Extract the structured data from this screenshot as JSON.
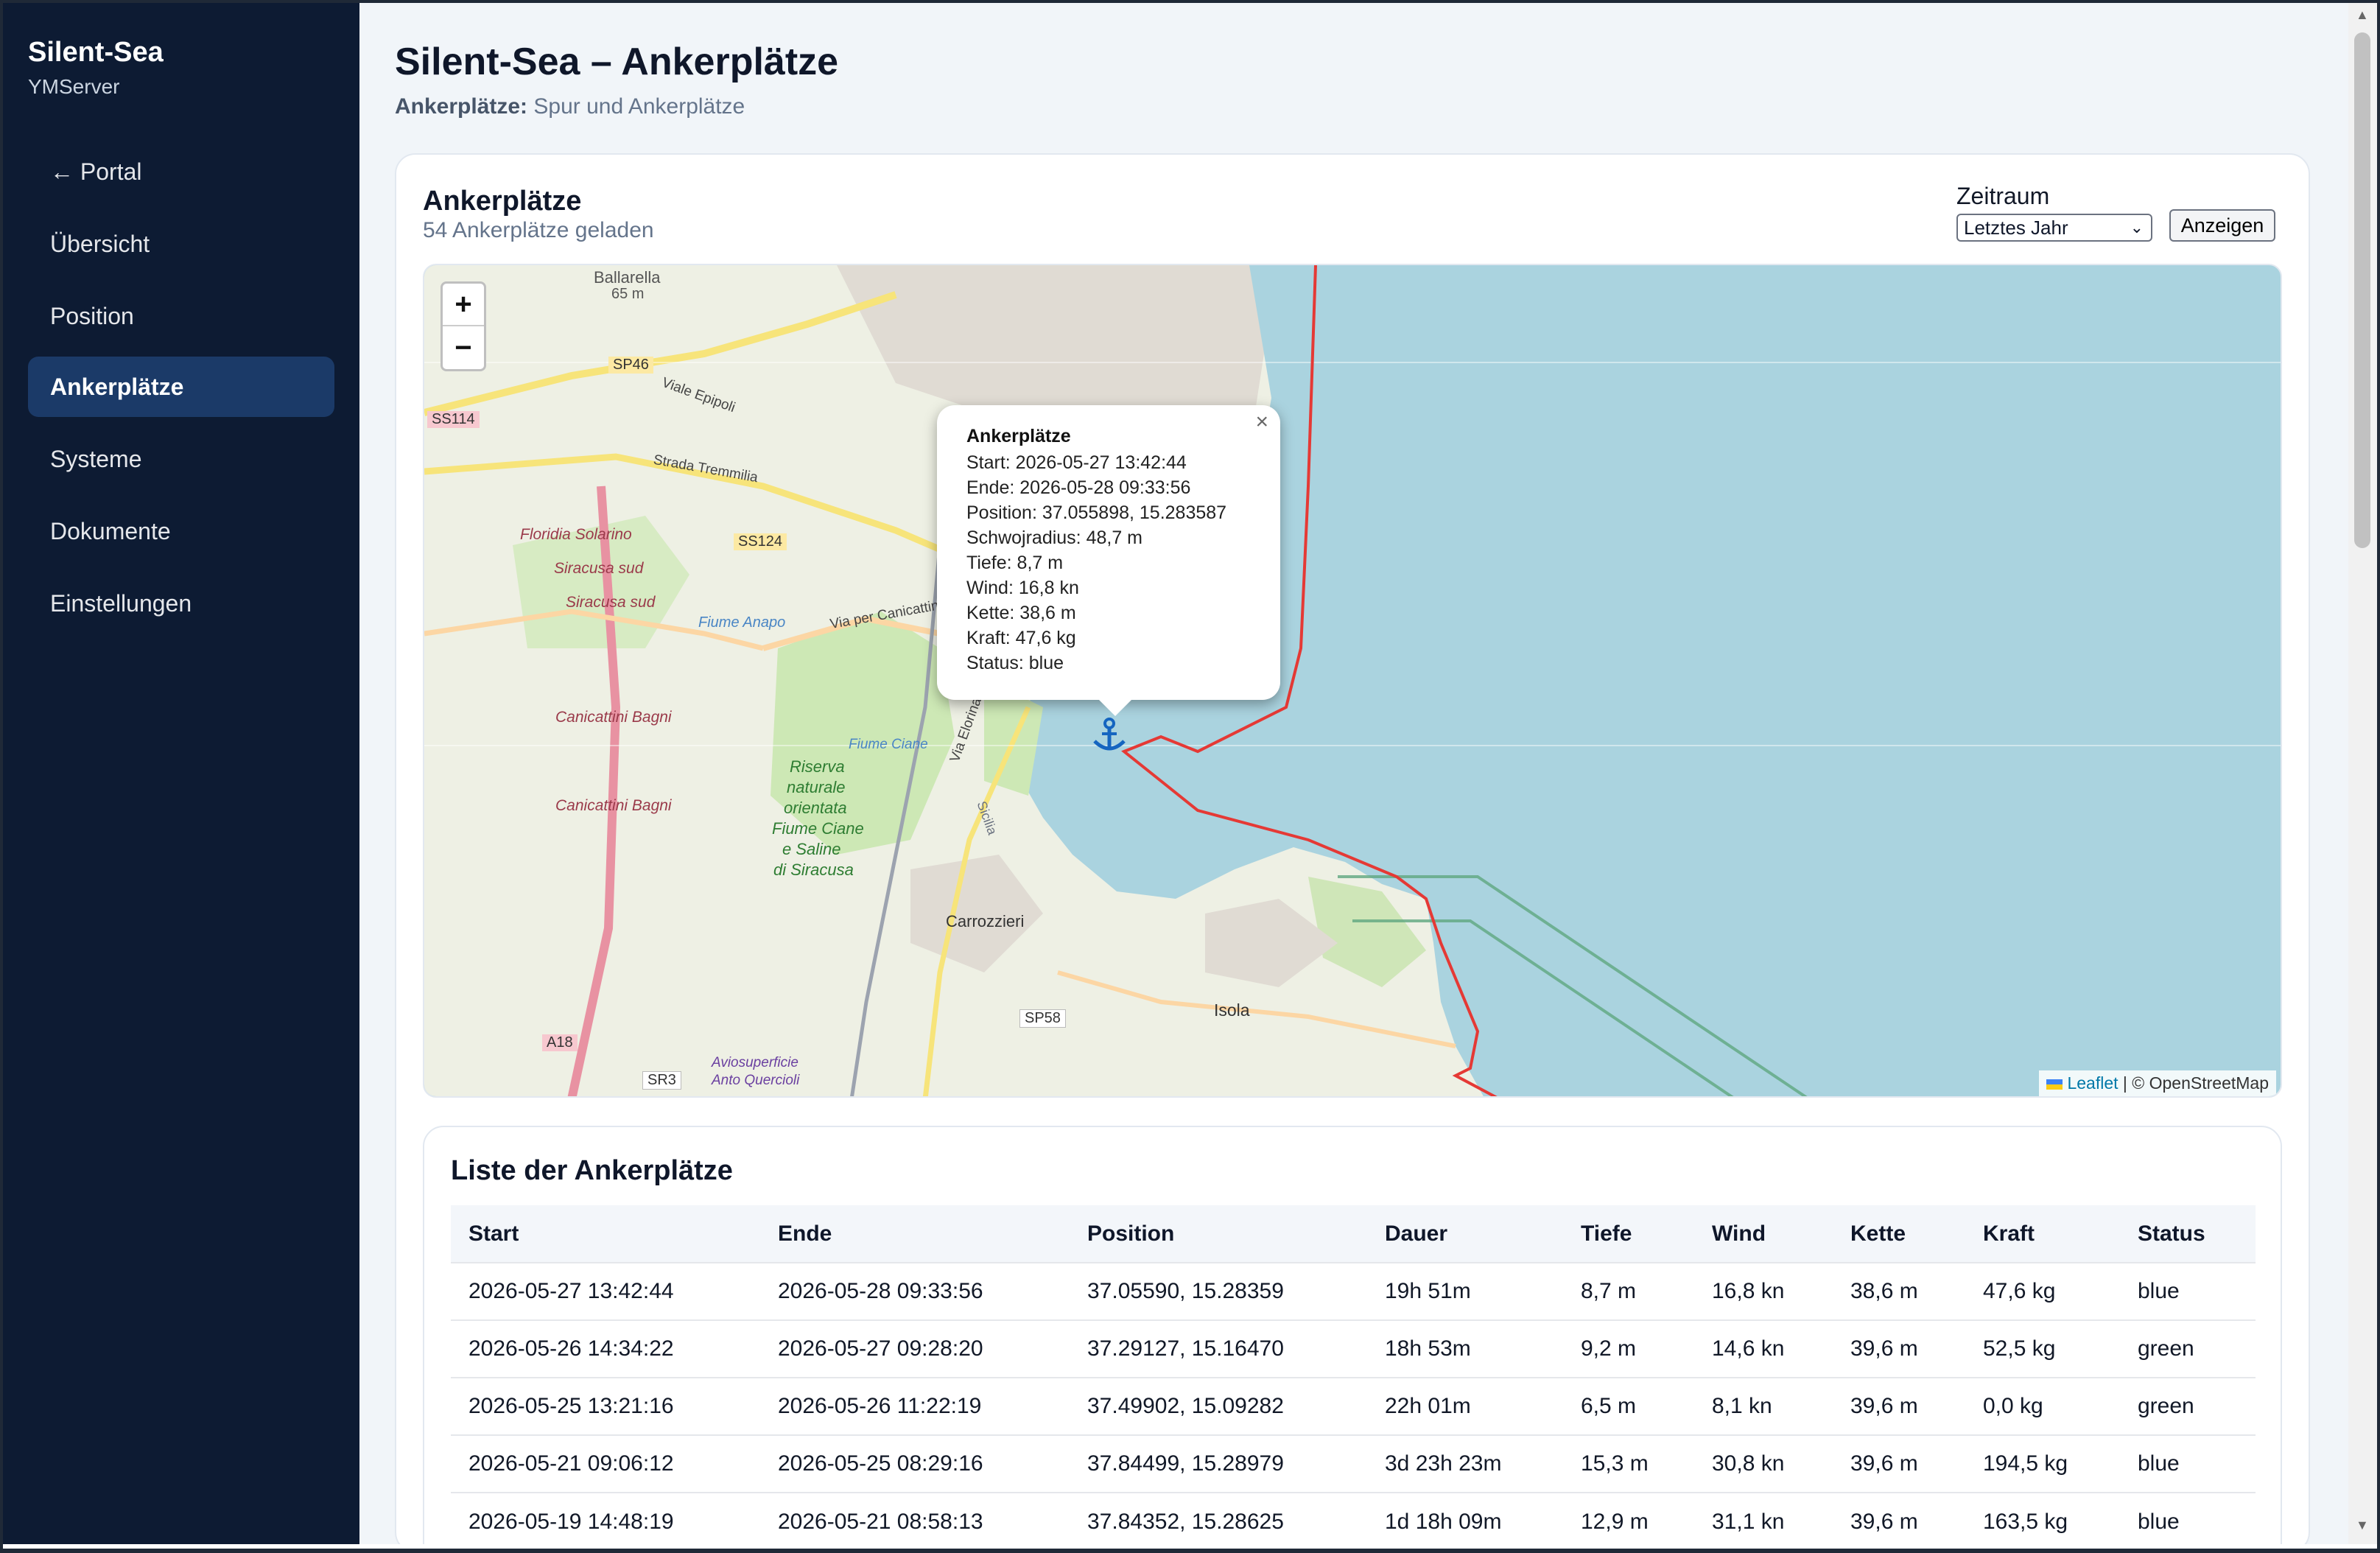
{
  "sidebar": {
    "brand_title": "Silent-Sea",
    "brand_sub": "YMServer",
    "items": [
      {
        "label": "← Portal"
      },
      {
        "label": "Übersicht"
      },
      {
        "label": "Position"
      },
      {
        "label": "Ankerplätze"
      },
      {
        "label": "Systeme"
      },
      {
        "label": "Dokumente"
      },
      {
        "label": "Einstellungen"
      }
    ],
    "active_index": 3
  },
  "header": {
    "title": "Silent-Sea – Ankerplätze",
    "sub_bold": "Ankerplätze:",
    "sub_rest": " Spur und Ankerplätze"
  },
  "card": {
    "title": "Ankerplätze",
    "count": "54 Ankerplätze geladen",
    "period_label": "Zeitraum",
    "period_selected": "Letztes Jahr",
    "show_button": "Anzeigen"
  },
  "map": {
    "zoom_in": "+",
    "zoom_out": "−",
    "attribution_leaflet": "Leaflet",
    "attribution_rest": " | © OpenStreetMap",
    "labels": [
      {
        "text": "Ballarella"
      },
      {
        "text": "65 m"
      },
      {
        "text": "SP46"
      },
      {
        "text": "SS114"
      },
      {
        "text": "Viale Epipoli"
      },
      {
        "text": "Strada Tremmilia"
      },
      {
        "text": "Floridia Solarino"
      },
      {
        "text": "SS124"
      },
      {
        "text": "Siracusa sud"
      },
      {
        "text": "Siracusa sud"
      },
      {
        "text": "Fiume Anapo"
      },
      {
        "text": "Via per Canicattini"
      },
      {
        "text": "Canicattini Bagni"
      },
      {
        "text": "Canicattini Bagni"
      },
      {
        "text": "Riserva"
      },
      {
        "text": "naturale"
      },
      {
        "text": "orientata"
      },
      {
        "text": "Fiume Ciane"
      },
      {
        "text": "e Saline"
      },
      {
        "text": "di Siracusa"
      },
      {
        "text": "Fiume Ciane"
      },
      {
        "text": "Carrozzieri"
      },
      {
        "text": "SP58"
      },
      {
        "text": "Isola"
      },
      {
        "text": "A18"
      },
      {
        "text": "SR3"
      },
      {
        "text": "Aviosuperficie"
      },
      {
        "text": "Anto Quercioli"
      },
      {
        "text": "Via Elorina"
      },
      {
        "text": "Sicilia"
      }
    ],
    "popup": {
      "title": "Ankerplätze",
      "lines": [
        "Start: 2026-05-27 13:42:44",
        "Ende: 2026-05-28 09:33:56",
        "Position: 37.055898, 15.283587",
        "Schwojradius: 48,7 m",
        "Tiefe: 8,7 m",
        "Wind: 16,8 kn",
        "Kette: 38,6 m",
        "Kraft: 47,6 kg",
        "Status: blue"
      ],
      "close": "×"
    },
    "colors": {
      "sea": "#aad3df",
      "land": "#f2efe9",
      "track": "#e53935",
      "anchor": "#1565c0"
    }
  },
  "list": {
    "title": "Liste der Ankerplätze",
    "columns": [
      "Start",
      "Ende",
      "Position",
      "Dauer",
      "Tiefe",
      "Wind",
      "Kette",
      "Kraft",
      "Status"
    ],
    "rows": [
      [
        "2026-05-27 13:42:44",
        "2026-05-28 09:33:56",
        "37.05590, 15.28359",
        "19h 51m",
        "8,7 m",
        "16,8 kn",
        "38,6 m",
        "47,6 kg",
        "blue"
      ],
      [
        "2026-05-26 14:34:22",
        "2026-05-27 09:28:20",
        "37.29127, 15.16470",
        "18h 53m",
        "9,2 m",
        "14,6 kn",
        "39,6 m",
        "52,5 kg",
        "green"
      ],
      [
        "2026-05-25 13:21:16",
        "2026-05-26 11:22:19",
        "37.49902, 15.09282",
        "22h 01m",
        "6,5 m",
        "8,1 kn",
        "39,6 m",
        "0,0 kg",
        "green"
      ],
      [
        "2026-05-21 09:06:12",
        "2026-05-25 08:29:16",
        "37.84499, 15.28979",
        "3d 23h 23m",
        "15,3 m",
        "30,8 kn",
        "39,6 m",
        "194,5 kg",
        "blue"
      ],
      [
        "2026-05-19 14:48:19",
        "2026-05-21 08:58:13",
        "37.84352, 15.28625",
        "1d 18h 09m",
        "12,9 m",
        "31,1 kn",
        "39,6 m",
        "163,5 kg",
        "blue"
      ]
    ]
  }
}
